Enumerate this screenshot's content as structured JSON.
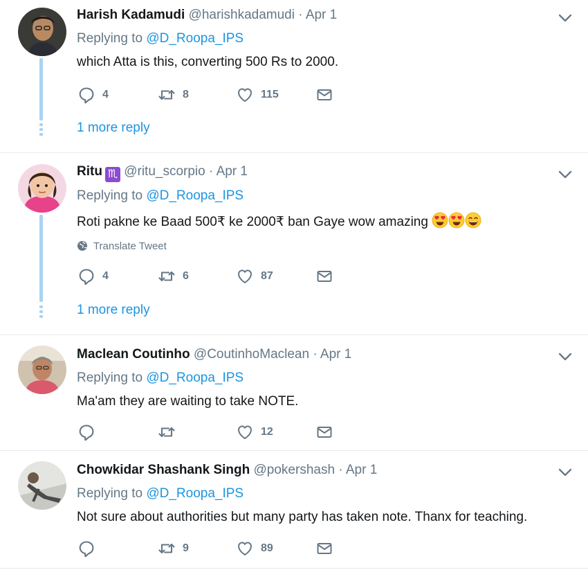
{
  "tweets": [
    {
      "name": "Harish Kadamudi",
      "handle": "@harishkadamudi",
      "date": "Apr 1",
      "replying_prefix": "Replying to",
      "mention": "@D_Roopa_IPS",
      "text": "which Atta is this, converting 500 Rs to 2000.",
      "replies": "4",
      "retweets": "8",
      "likes": "115",
      "more_reply": "1 more reply"
    },
    {
      "name": "Ritu",
      "sign": "♏",
      "handle": "@ritu_scorpio",
      "date": "Apr 1",
      "replying_prefix": "Replying to",
      "mention": "@D_Roopa_IPS",
      "text": "Roti pakne ke Baad 500₹ ke 2000₹ ban Gaye wow amazing",
      "emojis": [
        "heart-eyes-emoji",
        "heart-eyes-emoji",
        "grinning-emoji"
      ],
      "translate": "Translate Tweet",
      "replies": "4",
      "retweets": "6",
      "likes": "87",
      "more_reply": "1 more reply"
    },
    {
      "name": "Maclean Coutinho",
      "handle": "@CoutinhoMaclean",
      "date": "Apr 1",
      "replying_prefix": "Replying to",
      "mention": "@D_Roopa_IPS",
      "text": "Ma'am they are waiting to take NOTE.",
      "replies": "",
      "retweets": "",
      "likes": "12"
    },
    {
      "name": "Chowkidar Shashank Singh",
      "handle": "@pokershash",
      "date": "Apr 1",
      "replying_prefix": "Replying to",
      "mention": "@D_Roopa_IPS",
      "text": "Not sure about authorities but many party has taken note. Thanx for teaching.",
      "replies": "",
      "retweets": "9",
      "likes": "89"
    }
  ],
  "separator": "·",
  "colors": {
    "link": "#1b95e0",
    "muted": "#657786",
    "thread": "#a9d4f3",
    "divider": "#e6ecf0"
  },
  "icons": [
    "reply-icon",
    "retweet-icon",
    "like-icon",
    "direct-message-icon",
    "chevron-down-icon",
    "globe-icon"
  ]
}
